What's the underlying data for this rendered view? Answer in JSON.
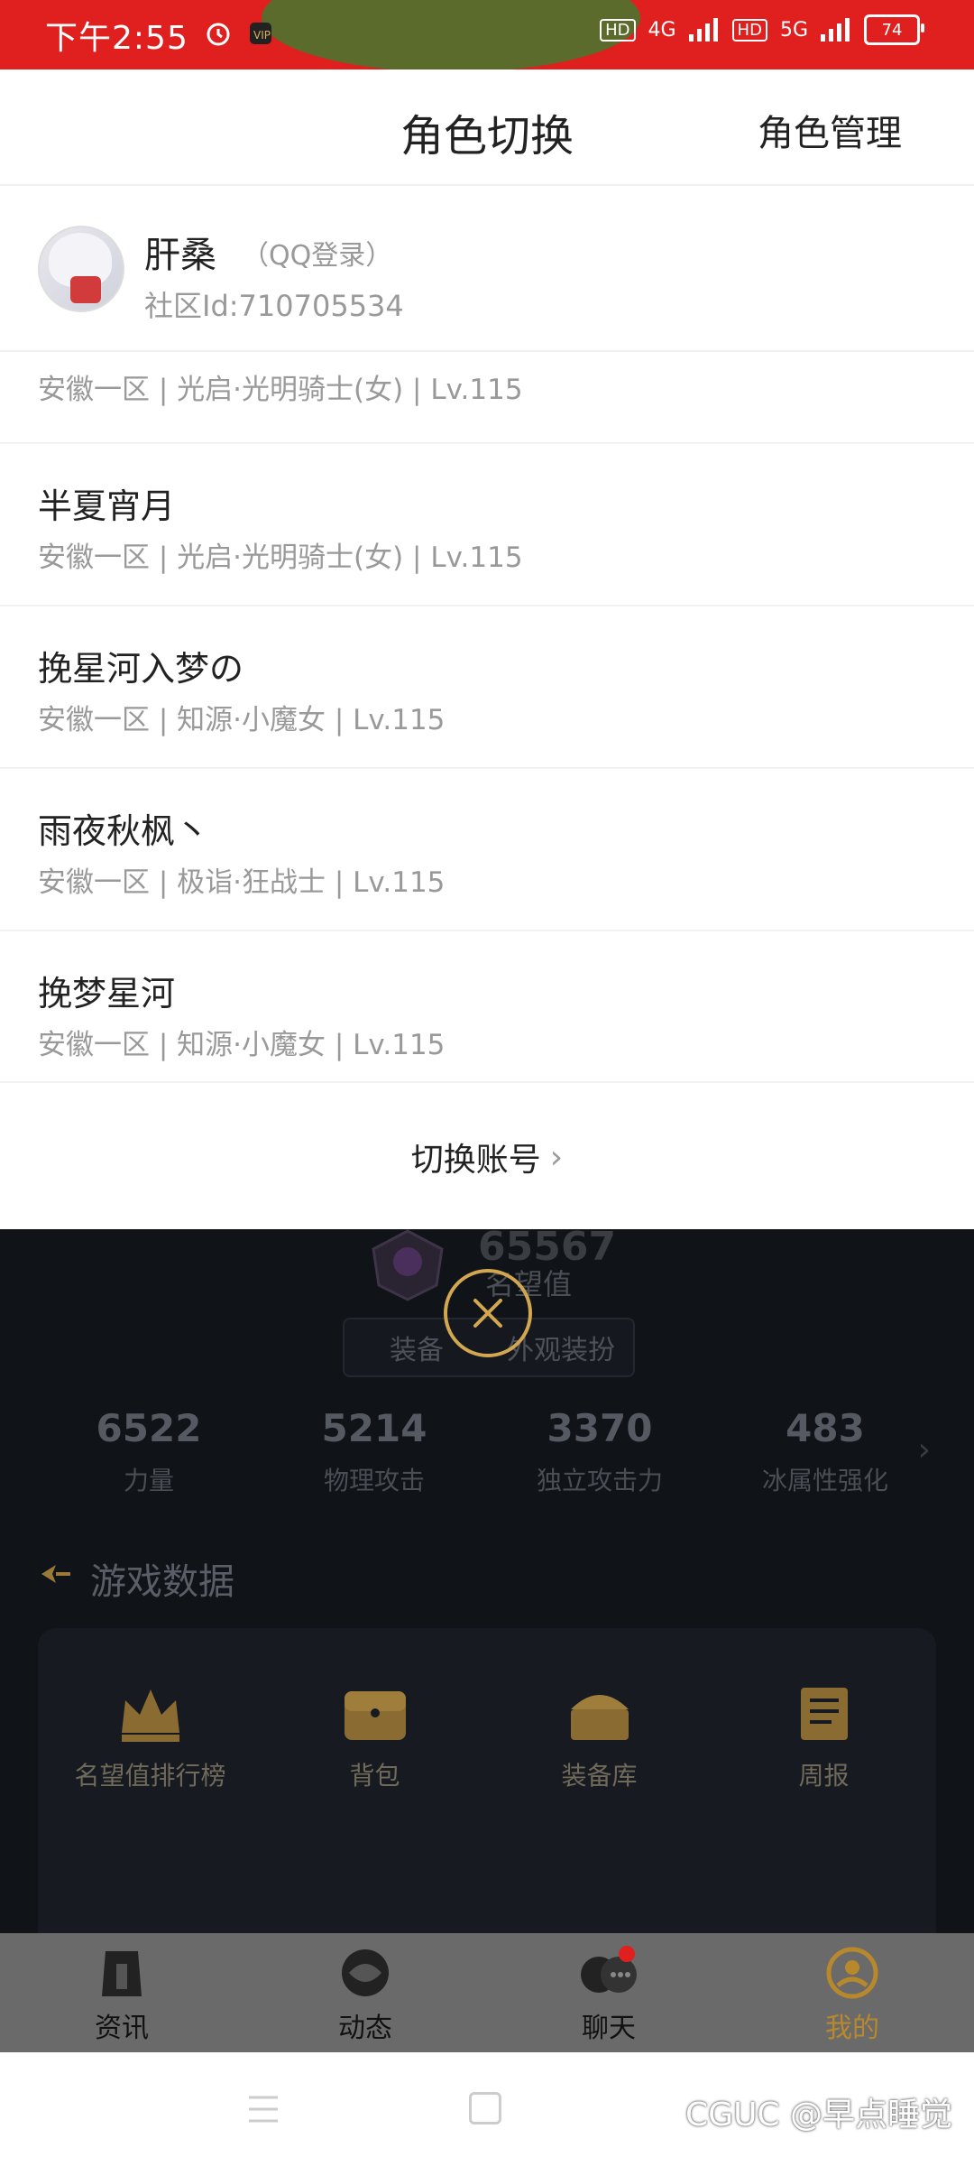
{
  "status": {
    "time": "下午2:55",
    "net1": "4G",
    "net2": "5G",
    "hd": "HD",
    "battery": "74"
  },
  "sheet": {
    "title": "角色切换",
    "manage": "角色管理",
    "account": {
      "name": "肝桑",
      "login": "（QQ登录）",
      "community_id": "社区Id:710705534"
    },
    "roles": [
      {
        "name": "",
        "info": "安徽一区 | 光启·光明骑士(女) | Lv.115"
      },
      {
        "name": "半夏宵月",
        "info": "安徽一区 | 光启·光明骑士(女) | Lv.115"
      },
      {
        "name": "挽星河入梦の",
        "info": "安徽一区 | 知源·小魔女 | Lv.115"
      },
      {
        "name": "雨夜秋枫丶",
        "info": "安徽一区 | 极诣·狂战士 | Lv.115"
      },
      {
        "name": "挽梦星河",
        "info": "安徽一区 | 知源·小魔女 | Lv.115"
      }
    ],
    "switch_account": "切换账号"
  },
  "background": {
    "prestige_value": "65567",
    "prestige_label": "名望值",
    "segments": [
      "装备",
      "外观装扮"
    ],
    "stats": [
      {
        "value": "6522",
        "label": "力量"
      },
      {
        "value": "5214",
        "label": "物理攻击"
      },
      {
        "value": "3370",
        "label": "独立攻击力"
      },
      {
        "value": "483",
        "label": "冰属性强化"
      }
    ],
    "section_title": "游戏数据",
    "grid": [
      {
        "label": "名望值排行榜",
        "icon": "crown-icon"
      },
      {
        "label": "背包",
        "icon": "bag-icon"
      },
      {
        "label": "装备库",
        "icon": "chest-icon"
      },
      {
        "label": "周报",
        "icon": "scroll-icon"
      }
    ]
  },
  "tabs": [
    {
      "label": "资讯",
      "icon": "news-icon"
    },
    {
      "label": "动态",
      "icon": "feed-icon"
    },
    {
      "label": "聊天",
      "icon": "chat-icon"
    },
    {
      "label": "我的",
      "icon": "profile-icon"
    }
  ],
  "watermark": "CGUC @早点睡觉"
}
